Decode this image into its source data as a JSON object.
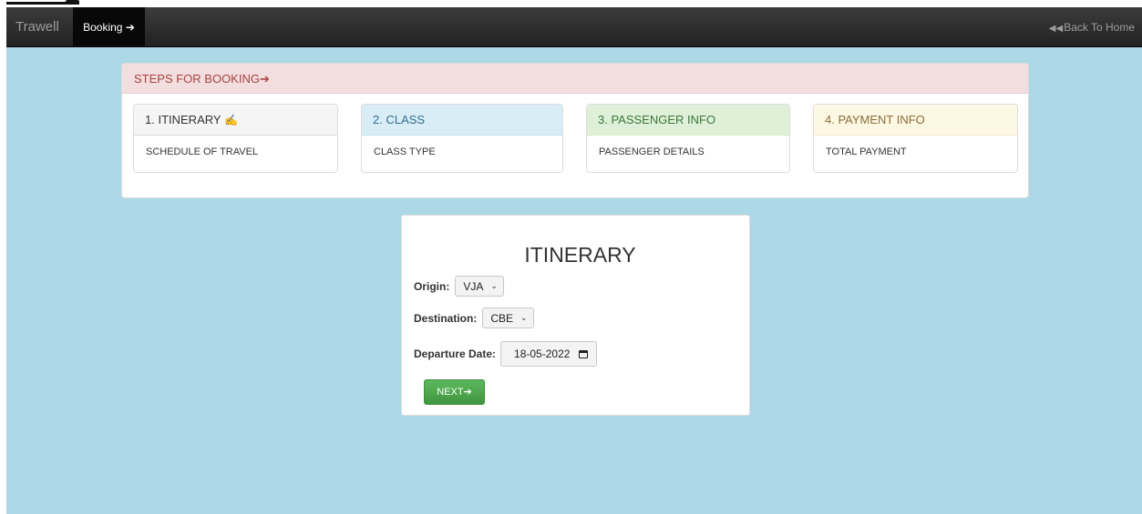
{
  "navbar": {
    "brand": "Trawell",
    "active_item": "Booking",
    "active_icon": "arrow-right-icon",
    "back_link": "Back To Home",
    "back_icon": "fast-backward-icon"
  },
  "steps": {
    "header": "STEPS FOR BOOKING",
    "header_icon": "arrow-right-icon",
    "items": [
      {
        "title": "1. ITINERARY",
        "body": "SCHEDULE OF TRAVEL",
        "icon": "check-mark-icon"
      },
      {
        "title": "2. CLASS",
        "body": "CLASS TYPE"
      },
      {
        "title": "3. PASSENGER INFO",
        "body": "PASSENGER DETAILS"
      },
      {
        "title": "4. PAYMENT INFO",
        "body": "TOTAL PAYMENT"
      }
    ]
  },
  "form": {
    "title": "ITINERARY",
    "origin_label": "Origin:",
    "origin_value": "VJA",
    "destination_label": "Destination:",
    "destination_value": "CBE",
    "date_label": "Departure Date:",
    "date_value": "18-05-2022",
    "next_label": "NEXT"
  },
  "colors": {
    "background": "#add8e6",
    "navbar": "#222222",
    "danger_heading": "#a94442",
    "success_button": "#5cb85c"
  }
}
